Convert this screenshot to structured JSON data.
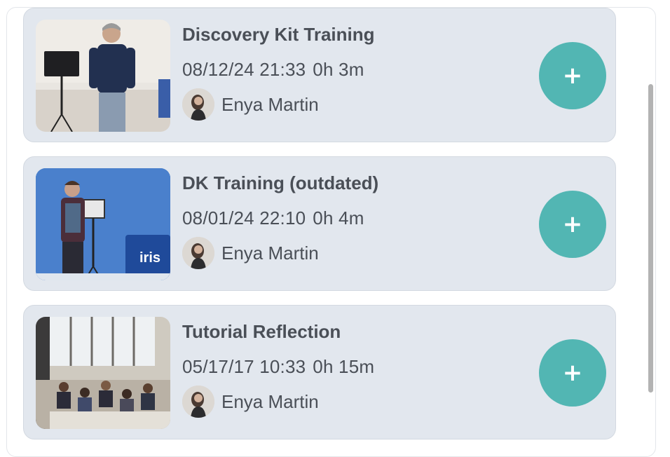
{
  "videos": [
    {
      "title": "Discovery Kit Training",
      "date": "08/12/24 21:33",
      "duration": "0h 3m",
      "owner": "Enya Martin",
      "add_label": "+"
    },
    {
      "title": "DK Training (outdated)",
      "date": "08/01/24 22:10",
      "duration": "0h 4m",
      "owner": "Enya Martin",
      "add_label": "+"
    },
    {
      "title": "Tutorial Reflection",
      "date": "05/17/17 10:33",
      "duration": "0h 15m",
      "owner": "Enya Martin",
      "add_label": "+"
    }
  ],
  "thumbnail_texts": {
    "iris_logo": "iris"
  },
  "colors": {
    "card_bg": "#e2e7ee",
    "add_button": "#52b6b3",
    "text": "#4a4f57"
  },
  "icons": {
    "add": "plus-icon"
  }
}
